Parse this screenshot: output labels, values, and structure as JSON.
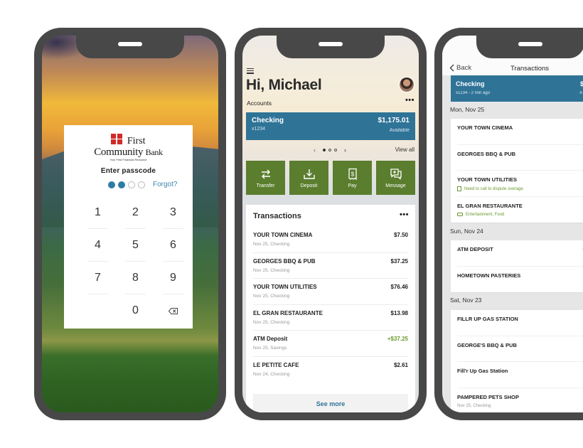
{
  "login_screen": {
    "logo": {
      "line1": "First",
      "line2": "Community",
      "line2_suffix": "Bank",
      "tagline": "Your First Financial Resource",
      "brand_color": "#d12a2a"
    },
    "prompt": "Enter passcode",
    "passcode_digits_entered": 2,
    "passcode_length": 4,
    "forgot_label": "Forgot?",
    "keypad": [
      "1",
      "2",
      "3",
      "4",
      "5",
      "6",
      "7",
      "8",
      "9",
      "",
      "0",
      "backspace"
    ]
  },
  "dashboard": {
    "greeting": "Hi, Michael",
    "accounts_label": "Accounts",
    "account": {
      "name": "Checking",
      "number": "x1234",
      "balance": "$1,175.01",
      "balance_label": "Available"
    },
    "pager": {
      "current": 1,
      "total": 3
    },
    "view_all_label": "View all",
    "actions": [
      {
        "label": "Transfer",
        "icon": "transfer-icon"
      },
      {
        "label": "Deposit",
        "icon": "deposit-icon"
      },
      {
        "label": "Pay",
        "icon": "pay-icon"
      },
      {
        "label": "Message",
        "icon": "message-icon"
      }
    ],
    "transactions_title": "Transactions",
    "transactions": [
      {
        "name": "YOUR TOWN CINEMA",
        "sub": "Nov 25, Checking",
        "amount": "$7.50",
        "credit": false
      },
      {
        "name": "GEORGES BBQ & PUB",
        "sub": "Nov 25, Checking",
        "amount": "$37.25",
        "credit": false
      },
      {
        "name": "YOUR TOWN UTILITIES",
        "sub": "Nov 25, Checking",
        "amount": "$76.46",
        "credit": false
      },
      {
        "name": "EL GRAN RESTAURANTE",
        "sub": "Nov 25, Checking",
        "amount": "$13.98",
        "credit": false
      },
      {
        "name": "ATM Deposit",
        "sub": "Nov 25, Savings",
        "amount": "+$37.25",
        "credit": true
      },
      {
        "name": "LE PETITE CAFE",
        "sub": "Nov 24, Checking",
        "amount": "$2.61",
        "credit": false
      }
    ],
    "see_more_label": "See more",
    "colors": {
      "account_blue": "#2f7397",
      "action_green": "#5a7e2e",
      "credit_green": "#6a9a2e"
    }
  },
  "transactions_screen": {
    "back_label": "Back",
    "title": "Transactions",
    "account": {
      "name": "Checking",
      "sub": "x1234 - 2 min ago",
      "balance_partial": "$",
      "balance_label_partial": "A"
    },
    "groups": [
      {
        "date": "Mon, Nov 25",
        "items": [
          {
            "name": "YOUR TOWN CINEMA"
          },
          {
            "name": "GEORGES BBQ & PUB"
          },
          {
            "name": "YOUR TOWN UTILITIES",
            "note": "Need to call to dispute overage."
          },
          {
            "name": "EL GRAN RESTAURANTE",
            "tags": "Entertainment, Food"
          }
        ]
      },
      {
        "date": "Sun, Nov 24",
        "items": [
          {
            "name": "ATM DEPOSIT",
            "amount_partial": "+"
          },
          {
            "name": "HOMETOWN PASTERIES"
          }
        ]
      },
      {
        "date": "Sat, Nov 23",
        "items": [
          {
            "name": "FILLR UP GAS STATION"
          },
          {
            "name": "GEORGE'S BBQ & PUB"
          },
          {
            "name": "Fill'r Up Gas Station"
          },
          {
            "name": "PAMPERED PETS SHOP",
            "sub": "Nov 25, Checking"
          }
        ]
      }
    ]
  }
}
